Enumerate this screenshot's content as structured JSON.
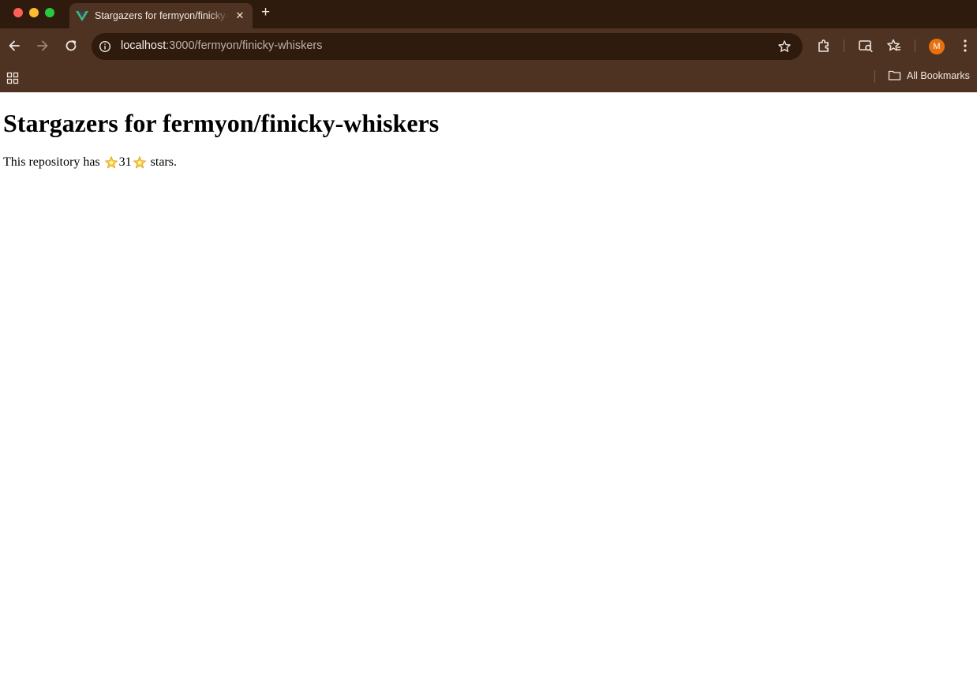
{
  "browser": {
    "tab": {
      "title": "Stargazers for fermyon/finicky-whiskers"
    },
    "address": {
      "host": "localhost",
      "path": ":3000/fermyon/finicky-whiskers"
    },
    "profile_initial": "M",
    "bookmarks_label": "All Bookmarks",
    "icons": [
      "back-icon",
      "forward-icon",
      "reload-icon",
      "site-info-icon",
      "bookmark-star-icon",
      "extensions-icon",
      "tab-search-icon",
      "reading-list-icon",
      "menu-icon",
      "apps-icon",
      "folder-icon",
      "new-tab-icon",
      "close-icon",
      "vue-favicon"
    ]
  },
  "page": {
    "heading": "Stargazers for fermyon/finicky-whiskers",
    "sentence_prefix": "This repository has ",
    "star_count": "31",
    "sentence_suffix": " stars."
  },
  "colors": {
    "frame": "#2f1a0e",
    "toolbar": "#4f3322",
    "avatar": "#e8700f"
  }
}
